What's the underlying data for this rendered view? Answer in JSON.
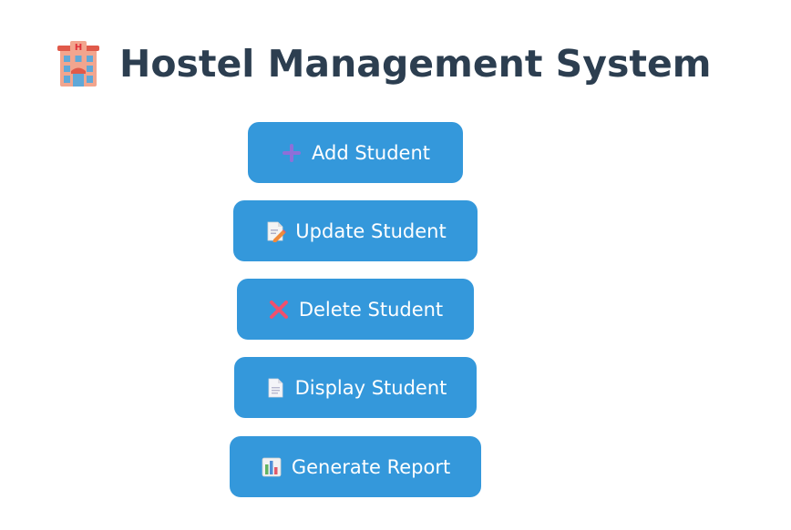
{
  "header": {
    "icon": "hotel-building-icon",
    "title": "Hostel Management System"
  },
  "menu": {
    "buttons": [
      {
        "label": "Add Student",
        "icon": "plus-icon"
      },
      {
        "label": "Update Student",
        "icon": "memo-pencil-icon"
      },
      {
        "label": "Delete Student",
        "icon": "cross-mark-icon"
      },
      {
        "label": "Display Student",
        "icon": "document-icon"
      },
      {
        "label": "Generate Report",
        "icon": "bar-chart-icon"
      }
    ]
  },
  "colors": {
    "title": "#2c3e50",
    "button_bg": "#3498db",
    "button_text": "#ffffff"
  }
}
